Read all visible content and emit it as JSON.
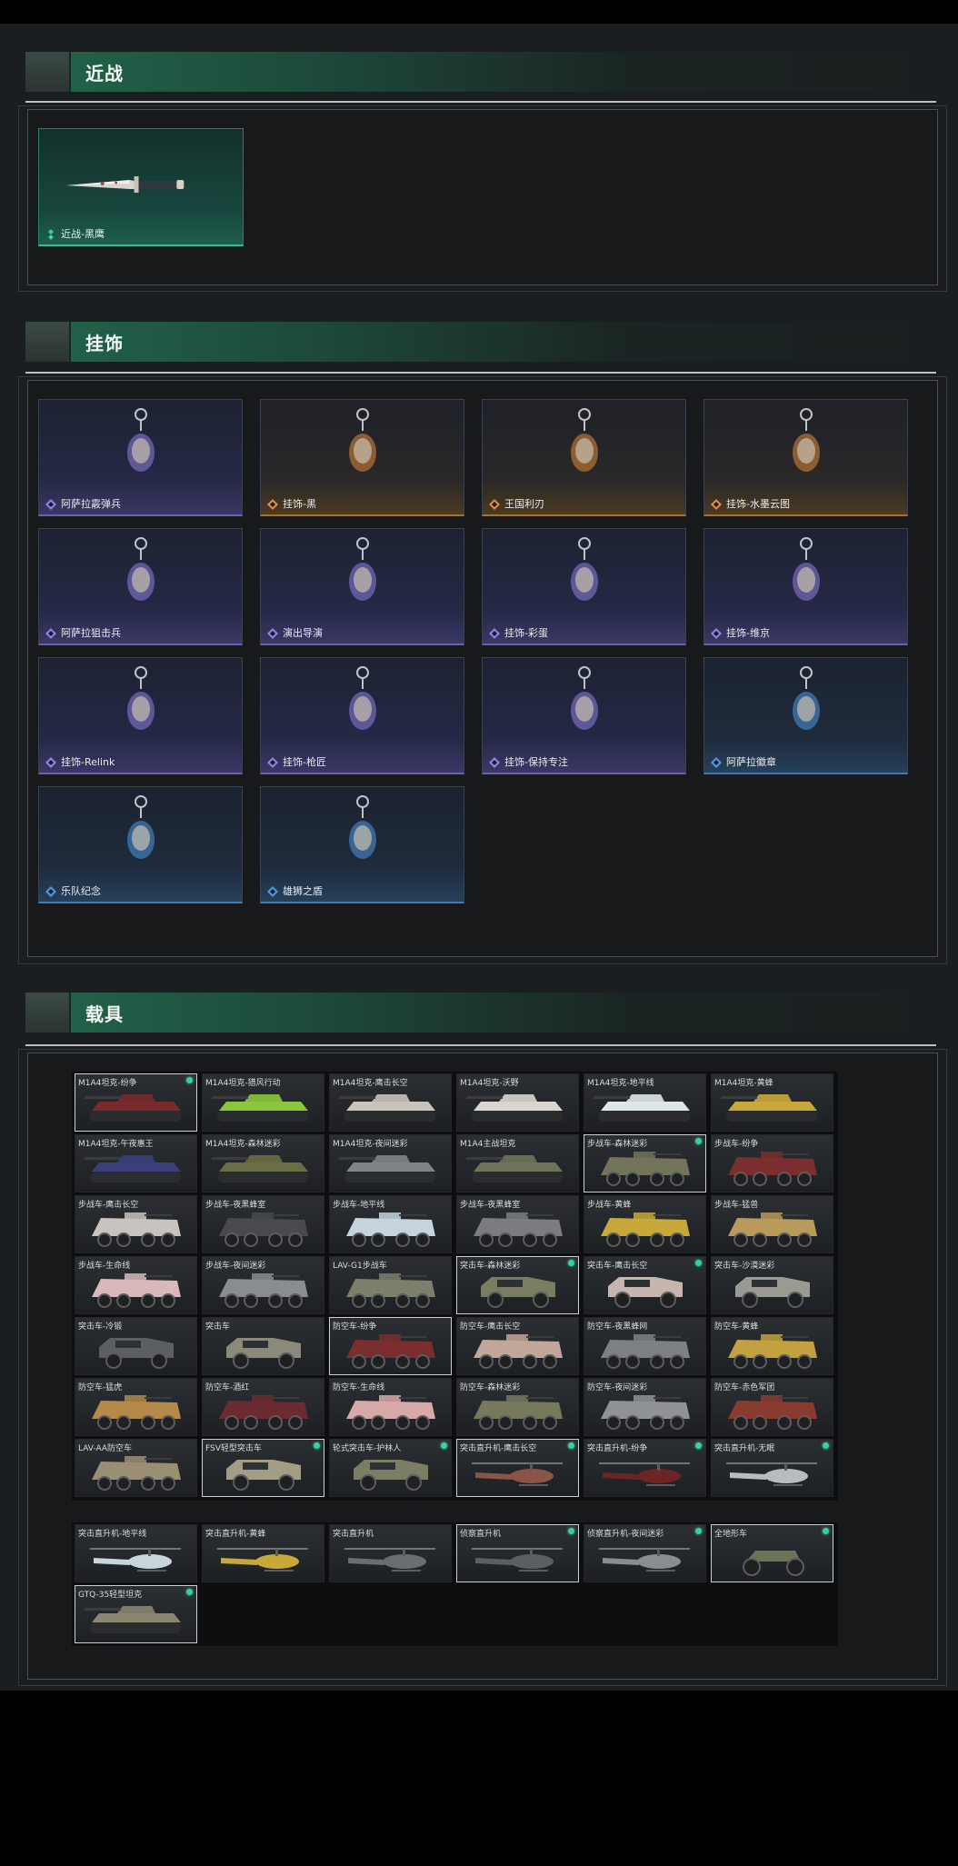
{
  "sections": {
    "melee": {
      "title": "近战",
      "items": [
        {
          "label": "近战-黑鹰",
          "rarity": "green"
        }
      ]
    },
    "charms": {
      "title": "挂饰",
      "items": [
        {
          "label": "阿萨拉霰弹兵",
          "rarity": "purple"
        },
        {
          "label": "挂饰-黑",
          "rarity": "orange"
        },
        {
          "label": "王国利刃",
          "rarity": "orange"
        },
        {
          "label": "挂饰-水墨云图",
          "rarity": "orange"
        },
        {
          "label": "阿萨拉狙击兵",
          "rarity": "purple"
        },
        {
          "label": "演出导演",
          "rarity": "purple"
        },
        {
          "label": "挂饰-彩蛋",
          "rarity": "purple"
        },
        {
          "label": "挂饰-维京",
          "rarity": "purple"
        },
        {
          "label": "挂饰-Relink",
          "rarity": "purple"
        },
        {
          "label": "挂饰-枪匠",
          "rarity": "purple"
        },
        {
          "label": "挂饰-保持专注",
          "rarity": "purple"
        },
        {
          "label": "阿萨拉徽章",
          "rarity": "blue"
        },
        {
          "label": "乐队纪念",
          "rarity": "blue"
        },
        {
          "label": "雄狮之盾",
          "rarity": "blue"
        }
      ]
    },
    "vehicles": {
      "title": "载具",
      "grid_main": [
        {
          "name": "M1A4坦克-纷争",
          "owned": true,
          "dot": true,
          "kind": "tank",
          "color": "#7a2a2a"
        },
        {
          "name": "M1A4坦克-猎风行动",
          "owned": false,
          "dot": false,
          "kind": "tank",
          "color": "#8bc63a"
        },
        {
          "name": "M1A4坦克-鹰击长空",
          "owned": false,
          "dot": false,
          "kind": "tank",
          "color": "#c9c3bb"
        },
        {
          "name": "M1A4坦克-沃野",
          "owned": false,
          "dot": false,
          "kind": "tank",
          "color": "#d8d6cf"
        },
        {
          "name": "M1A4坦克-地平线",
          "owned": false,
          "dot": false,
          "kind": "tank",
          "color": "#dfe6ea"
        },
        {
          "name": "M1A4坦克-黄蜂",
          "owned": false,
          "dot": false,
          "kind": "tank",
          "color": "#c9a83a"
        },
        {
          "name": "M1A4坦克-午夜惠王",
          "owned": false,
          "dot": false,
          "kind": "tank",
          "color": "#3a3f7a"
        },
        {
          "name": "M1A4坦克-森林迷彩",
          "owned": false,
          "dot": false,
          "kind": "tank",
          "color": "#6b6e45"
        },
        {
          "name": "M1A4坦克-夜间迷彩",
          "owned": false,
          "dot": false,
          "kind": "tank",
          "color": "#7f8488"
        },
        {
          "name": "M1A4主战坦克",
          "owned": false,
          "dot": false,
          "kind": "tank",
          "color": "#6f7458"
        },
        {
          "name": "步战车-森林迷彩",
          "owned": true,
          "dot": true,
          "kind": "ifv",
          "color": "#74745a"
        },
        {
          "name": "步战车-纷争",
          "owned": false,
          "dot": false,
          "kind": "ifv",
          "color": "#7a2e2e"
        },
        {
          "name": "步战车-鹰击长空",
          "owned": false,
          "dot": false,
          "kind": "ifv",
          "color": "#c8c3be"
        },
        {
          "name": "步战车-夜黑蜂室",
          "owned": false,
          "dot": false,
          "kind": "ifv",
          "color": "#4a4a4e"
        },
        {
          "name": "步战车-地平线",
          "owned": false,
          "dot": false,
          "kind": "ifv",
          "color": "#c7d3dc"
        },
        {
          "name": "步战车-夜黑蜂室",
          "owned": false,
          "dot": false,
          "kind": "ifv",
          "color": "#7c7c80"
        },
        {
          "name": "步战车-黄蜂",
          "owned": false,
          "dot": false,
          "kind": "ifv",
          "color": "#c9a83a"
        },
        {
          "name": "步战车-猛兽",
          "owned": false,
          "dot": false,
          "kind": "ifv",
          "color": "#b89a5a"
        },
        {
          "name": "步战车-生命线",
          "owned": false,
          "dot": false,
          "kind": "ifv",
          "color": "#d8b8b8"
        },
        {
          "name": "步战车-夜间迷彩",
          "owned": false,
          "dot": false,
          "kind": "ifv",
          "color": "#8a8d90"
        },
        {
          "name": "LAV-G1步战车",
          "owned": false,
          "dot": false,
          "kind": "ifv",
          "color": "#7b7f6b"
        },
        {
          "name": "突击车-森林迷彩",
          "owned": true,
          "dot": true,
          "kind": "truck",
          "color": "#7a7d62"
        },
        {
          "name": "突击车-鹰击长空",
          "owned": false,
          "dot": true,
          "kind": "truck",
          "color": "#c6b6ad"
        },
        {
          "name": "突击车-沙漠迷彩",
          "owned": false,
          "dot": false,
          "kind": "truck",
          "color": "#9a9a92"
        },
        {
          "name": "突击车-冷锻",
          "owned": false,
          "dot": false,
          "kind": "truck",
          "color": "#5b5f63"
        },
        {
          "name": "突击车",
          "owned": false,
          "dot": false,
          "kind": "truck",
          "color": "#8b8a78"
        },
        {
          "name": "防空车-纷争",
          "owned": true,
          "dot": false,
          "kind": "ifv",
          "color": "#7a2e2e"
        },
        {
          "name": "防空车-鹰击长空",
          "owned": false,
          "dot": false,
          "kind": "ifv",
          "color": "#c2a69a"
        },
        {
          "name": "防空车-夜黑蜂网",
          "owned": false,
          "dot": false,
          "kind": "ifv",
          "color": "#7d8185"
        },
        {
          "name": "防空车-黄蜂",
          "owned": false,
          "dot": false,
          "kind": "ifv",
          "color": "#c3a13e"
        },
        {
          "name": "防空车-猛虎",
          "owned": false,
          "dot": false,
          "kind": "ifv",
          "color": "#b48a4a"
        },
        {
          "name": "防空车-酒红",
          "owned": false,
          "dot": false,
          "kind": "ifv",
          "color": "#6c2b30"
        },
        {
          "name": "防空车-生命线",
          "owned": false,
          "dot": false,
          "kind": "ifv",
          "color": "#d8a9a9"
        },
        {
          "name": "防空车-森林迷彩",
          "owned": false,
          "dot": false,
          "kind": "ifv",
          "color": "#76795c"
        },
        {
          "name": "防空车-夜间迷彩",
          "owned": false,
          "dot": false,
          "kind": "ifv",
          "color": "#909396"
        },
        {
          "name": "防空车-赤色军团",
          "owned": false,
          "dot": false,
          "kind": "ifv",
          "color": "#8a3b30"
        },
        {
          "name": "LAV-AA防空车",
          "owned": false,
          "dot": false,
          "kind": "ifv",
          "color": "#9a8f72"
        },
        {
          "name": "FSV轻型突击车",
          "owned": true,
          "dot": true,
          "kind": "truck",
          "color": "#a39d85"
        },
        {
          "name": "轮式突击车-护林人",
          "owned": false,
          "dot": true,
          "kind": "truck",
          "color": "#7b7e62"
        },
        {
          "name": "突击直升机-鹰击长空",
          "owned": true,
          "dot": true,
          "kind": "heli",
          "color": "#8a5446"
        },
        {
          "name": "突击直升机-纷争",
          "owned": false,
          "dot": true,
          "kind": "heli",
          "color": "#6c2424"
        },
        {
          "name": "突击直升机-无眠",
          "owned": false,
          "dot": true,
          "kind": "heli",
          "color": "#b8bcc0"
        }
      ],
      "grid_second": [
        {
          "name": "突击直升机-地平线",
          "owned": false,
          "dot": false,
          "kind": "heli",
          "color": "#c9d5dd"
        },
        {
          "name": "突击直升机-黄蜂",
          "owned": false,
          "dot": false,
          "kind": "heli",
          "color": "#c9a83a"
        },
        {
          "name": "突击直升机",
          "owned": false,
          "dot": false,
          "kind": "heli",
          "color": "#6a6e70"
        },
        {
          "name": "侦察直升机",
          "owned": true,
          "dot": true,
          "kind": "heli",
          "color": "#5b5f61"
        },
        {
          "name": "侦察直升机-夜间迷彩",
          "owned": false,
          "dot": true,
          "kind": "heli",
          "color": "#8a8d90"
        },
        {
          "name": "全地形车",
          "owned": true,
          "dot": true,
          "kind": "atv",
          "color": "#6f735a"
        },
        {
          "name": "GTQ-35轻型坦克",
          "owned": true,
          "dot": true,
          "kind": "tank",
          "color": "#8a8670"
        }
      ]
    }
  }
}
